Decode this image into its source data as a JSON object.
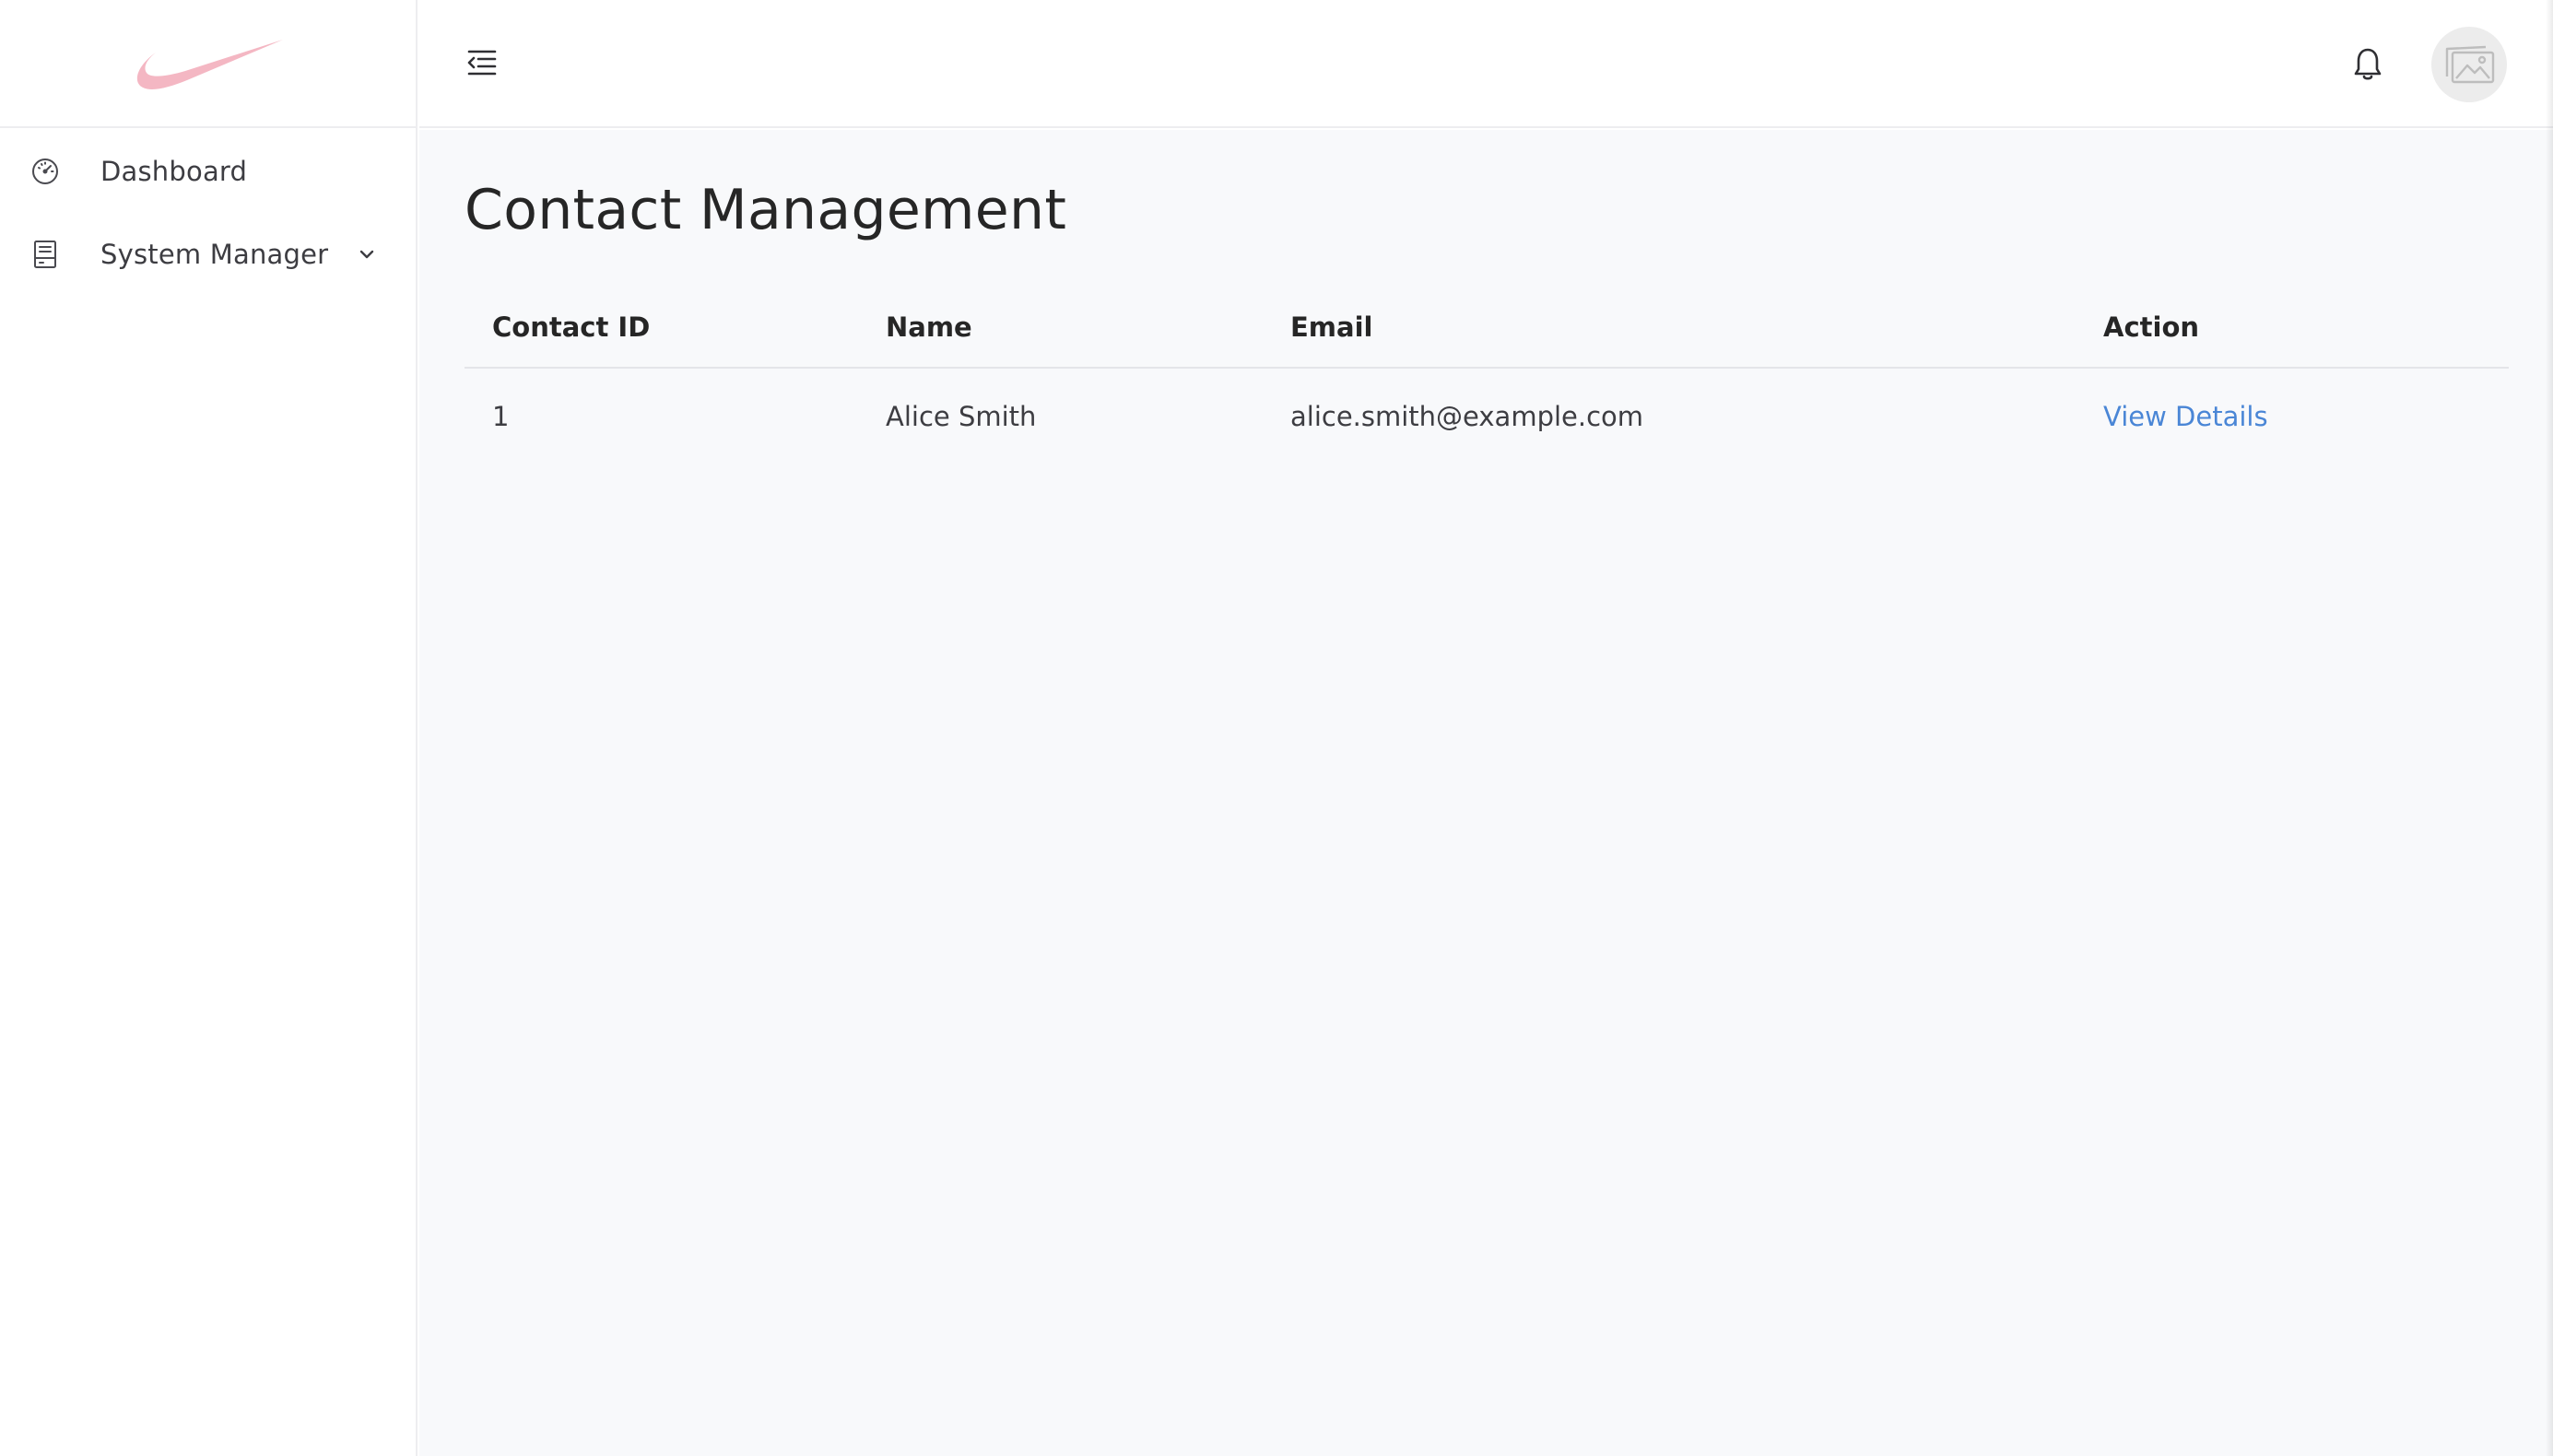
{
  "brand": {
    "logo_icon": "swoosh-logo",
    "logo_color": "#f4b7c3"
  },
  "sidebar": {
    "items": [
      {
        "label": "Dashboard",
        "icon": "speedometer-icon"
      },
      {
        "label": "System Manager",
        "icon": "document-list-icon",
        "expandable": true
      }
    ]
  },
  "header": {
    "menu_icon": "collapse-menu-icon",
    "notification_icon": "bell-icon",
    "avatar_icon": "image-placeholder-icon"
  },
  "main": {
    "title": "Contact Management",
    "table": {
      "columns": [
        "Contact ID",
        "Name",
        "Email",
        "Action"
      ],
      "rows": [
        {
          "id": "1",
          "name": "Alice Smith",
          "email": "alice.smith@example.com",
          "action": "View Details"
        }
      ]
    }
  },
  "colors": {
    "link": "#4a86d6",
    "content_bg": "#f8f9fb",
    "border": "#ededf0"
  }
}
